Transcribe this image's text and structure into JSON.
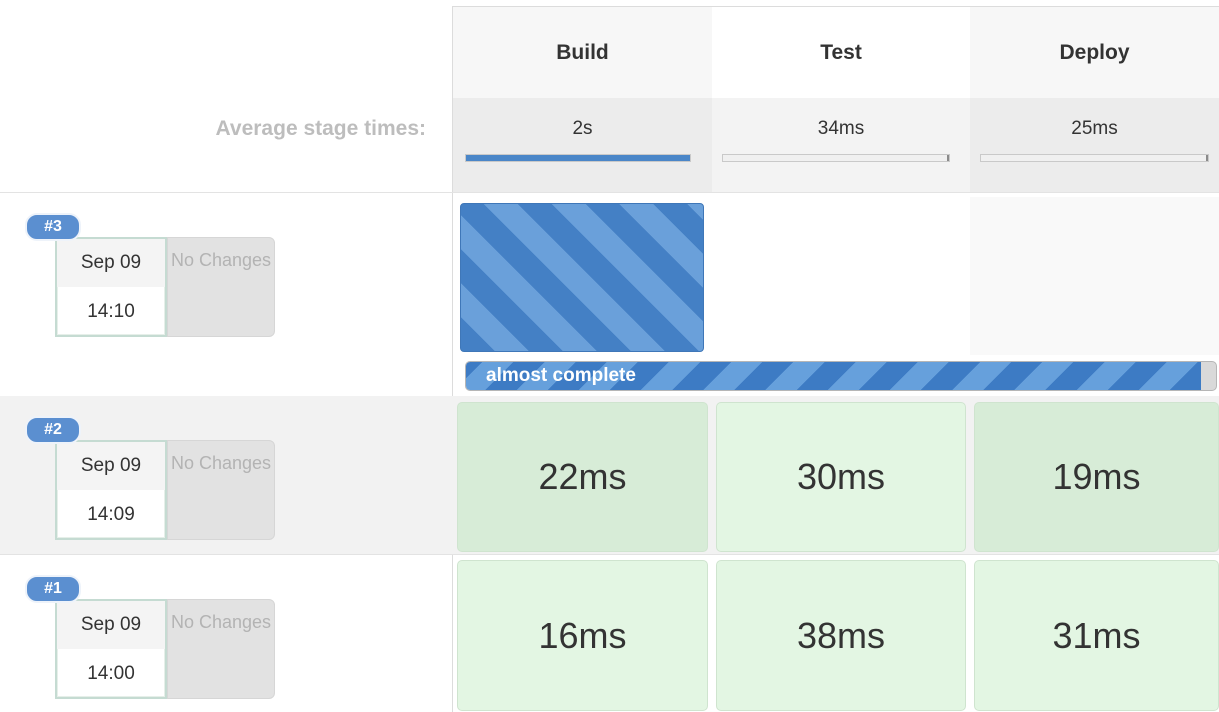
{
  "stages": [
    "Build",
    "Test",
    "Deploy"
  ],
  "average": {
    "label": "Average stage times:",
    "times": [
      "2s",
      "34ms",
      "25ms"
    ],
    "bar_fill": [
      1.0,
      0.0,
      0.0
    ]
  },
  "builds": [
    {
      "number": "#3",
      "date": "Sep 09",
      "time": "14:10",
      "changes": "No Changes",
      "status": "running",
      "progress": {
        "label": "almost complete",
        "fraction": 0.98
      },
      "stage_times": [
        "",
        "",
        ""
      ]
    },
    {
      "number": "#2",
      "date": "Sep 09",
      "time": "14:09",
      "changes": "No Changes",
      "status": "success",
      "stage_times": [
        "22ms",
        "30ms",
        "19ms"
      ]
    },
    {
      "number": "#1",
      "date": "Sep 09",
      "time": "14:00",
      "changes": "No Changes",
      "status": "success",
      "stage_times": [
        "16ms",
        "38ms",
        "31ms"
      ]
    }
  ],
  "colors": {
    "running": "#4480c5",
    "success_dark": "#d7ecd7",
    "success_light": "#e3f6e3",
    "build_badge": "#5b8fd0"
  }
}
